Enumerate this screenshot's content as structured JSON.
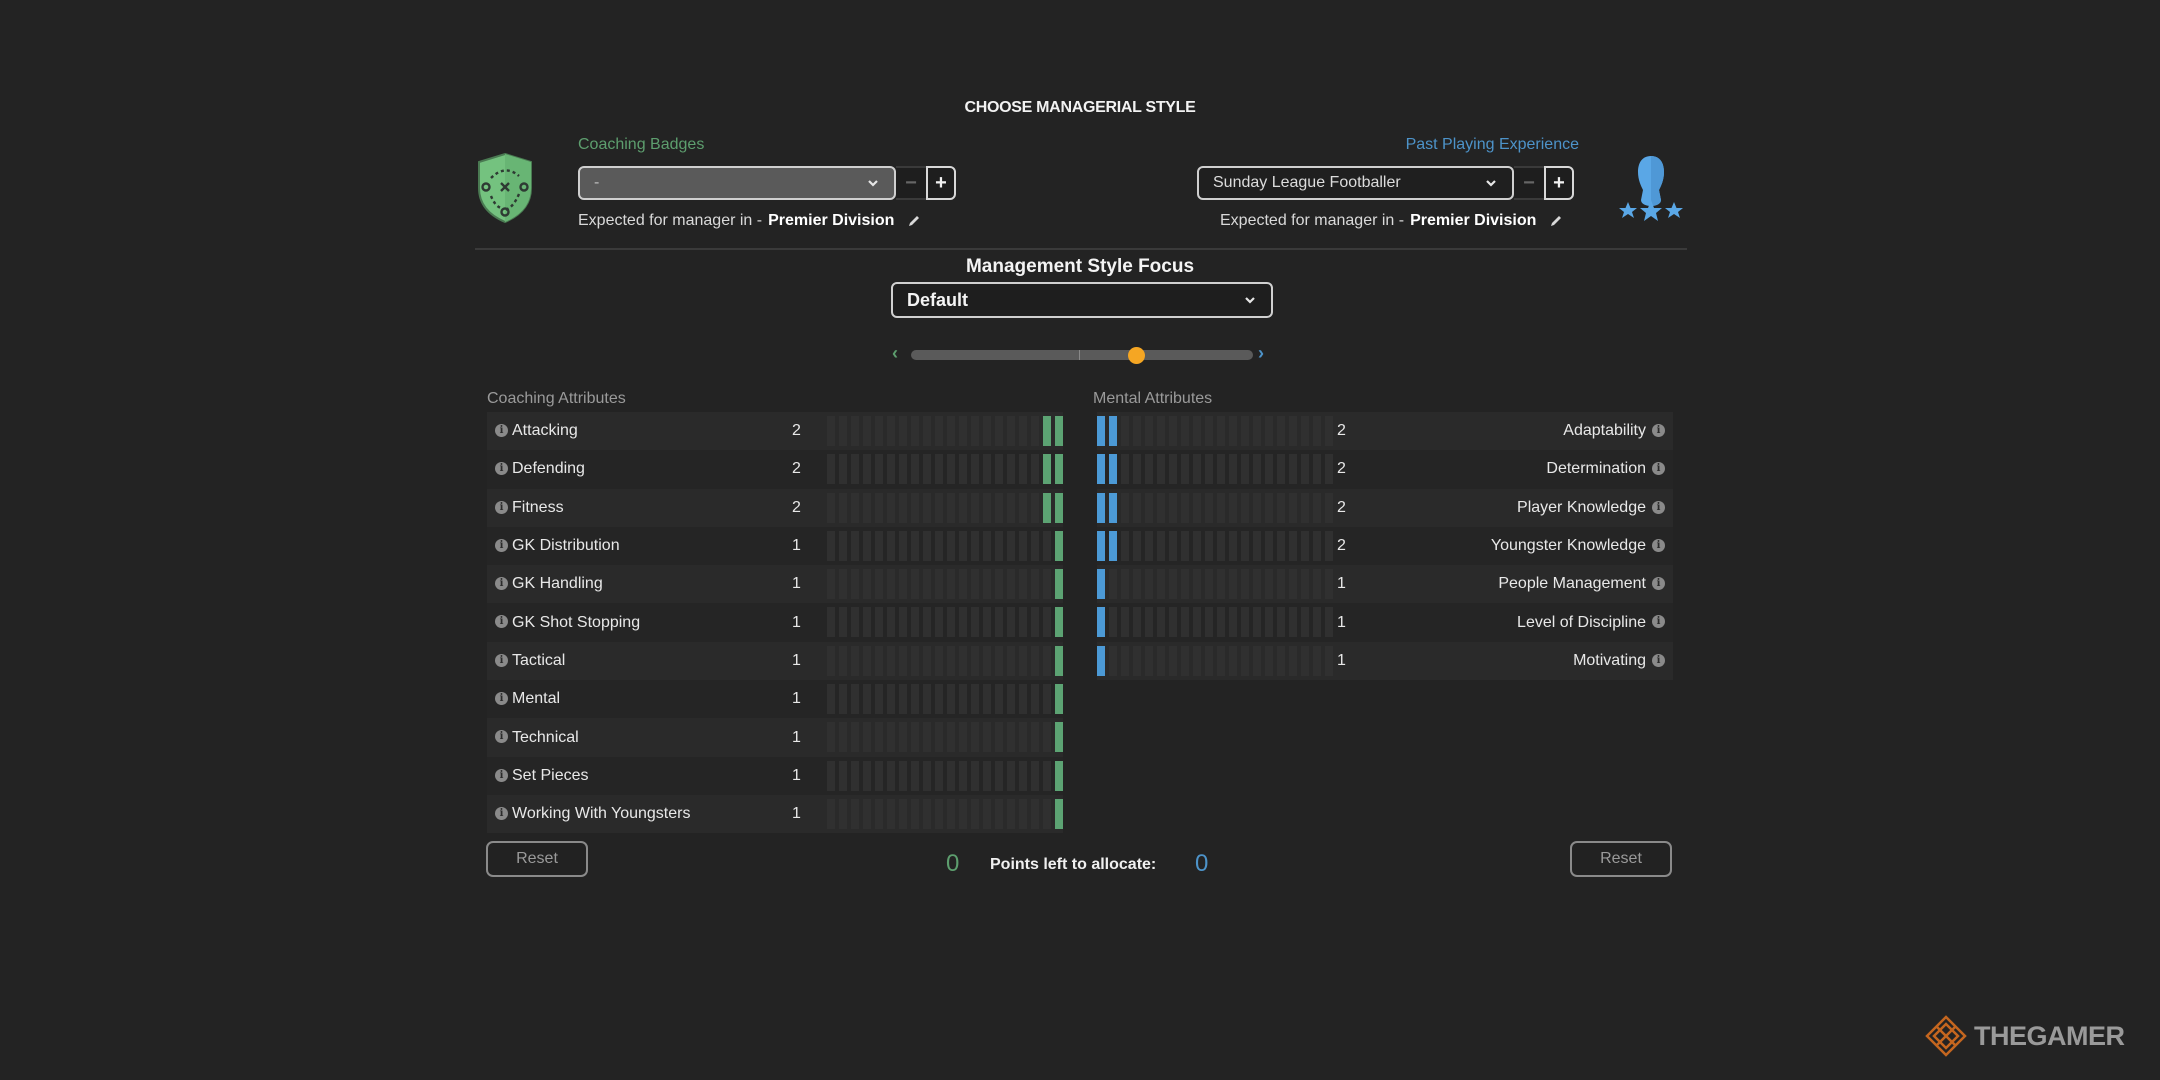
{
  "title": "CHOOSE MANAGERIAL STYLE",
  "coaching_badges": {
    "label": "Coaching Badges",
    "selected": "-",
    "minus": "−",
    "plus": "+",
    "expected_prefix": "Expected for manager in  -",
    "expected_division": "Premier Division",
    "icon": "tactics-shield-icon"
  },
  "past_playing": {
    "label": "Past Playing Experience",
    "selected": "Sunday League Footballer",
    "minus": "−",
    "plus": "+",
    "expected_prefix": "Expected for manager in  -",
    "expected_division": "Premier Division",
    "icon": "player-stars-icon"
  },
  "focus": {
    "title": "Management Style Focus",
    "selected": "Default",
    "slider_value_fraction": 0.66,
    "left_arrow": "‹",
    "right_arrow": "›"
  },
  "colors": {
    "coaching": "#5ca373",
    "mental": "#4c9ad6",
    "slider_thumb": "#f5a623"
  },
  "coaching_attributes": {
    "heading": "Coaching Attributes",
    "max_points": 20,
    "items": [
      {
        "name": "Attacking",
        "value": "2"
      },
      {
        "name": "Defending",
        "value": "2"
      },
      {
        "name": "Fitness",
        "value": "2"
      },
      {
        "name": "GK Distribution",
        "value": "1"
      },
      {
        "name": "GK Handling",
        "value": "1"
      },
      {
        "name": "GK Shot Stopping",
        "value": "1"
      },
      {
        "name": "Tactical",
        "value": "1"
      },
      {
        "name": "Mental",
        "value": "1"
      },
      {
        "name": "Technical",
        "value": "1"
      },
      {
        "name": "Set Pieces",
        "value": "1"
      },
      {
        "name": "Working With Youngsters",
        "value": "1"
      }
    ]
  },
  "mental_attributes": {
    "heading": "Mental Attributes",
    "max_points": 20,
    "items": [
      {
        "name": "Adaptability",
        "value": "2"
      },
      {
        "name": "Determination",
        "value": "2"
      },
      {
        "name": "Player Knowledge",
        "value": "2"
      },
      {
        "name": "Youngster Knowledge",
        "value": "2"
      },
      {
        "name": "People Management",
        "value": "1"
      },
      {
        "name": "Level of Discipline",
        "value": "1"
      },
      {
        "name": "Motivating",
        "value": "1"
      }
    ]
  },
  "footer": {
    "reset_label": "Reset",
    "coaching_points_left": "0",
    "points_label": "Points left to allocate:",
    "mental_points_left": "0"
  },
  "watermark": "THEGAMER"
}
